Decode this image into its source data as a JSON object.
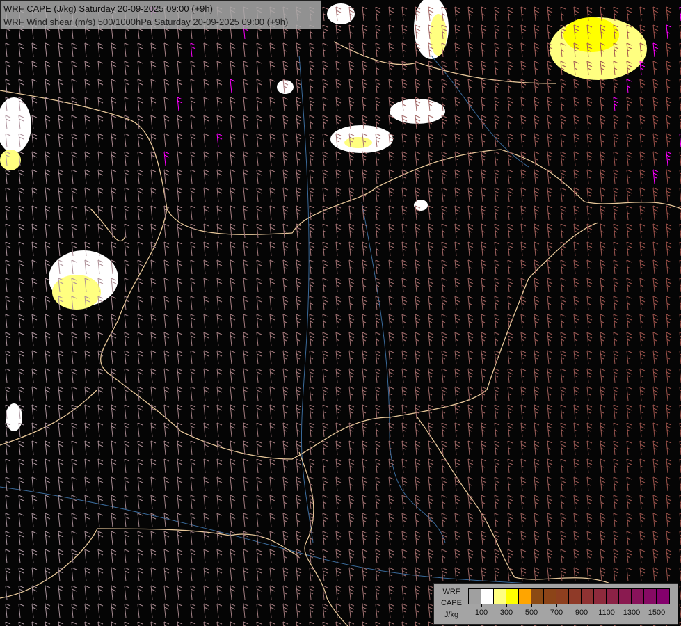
{
  "header": {
    "line1": "WRF CAPE (J/kg) Saturday 20-09-2025 09:00 (+9h)",
    "line2": "WRF Wind shear (m/s) 500/1000hPa Saturday 20-09-2025 09:00 (+9h)"
  },
  "legend": {
    "label_lines": [
      "WRF",
      "CAPE",
      "J/kg"
    ],
    "colors": [
      "#a0a0a0",
      "#ffffff",
      "#ffff80",
      "#ffff00",
      "#ffa500",
      "#8b4a14",
      "#8c4418",
      "#8e3f1f",
      "#8f3a28",
      "#8f3232",
      "#8e2a3c",
      "#8c2246",
      "#8a1a50",
      "#88125a",
      "#860a63",
      "#84006c"
    ],
    "tick_labels": [
      "100",
      "300",
      "500",
      "700",
      "900",
      "1100",
      "1300",
      "1500"
    ]
  },
  "colors": {
    "border": "#e8c89a",
    "river": "#3a6a9a",
    "barb_low": "#a89aa0",
    "barb_high": "#a04848",
    "barb_strong": "#ff00ff"
  }
}
